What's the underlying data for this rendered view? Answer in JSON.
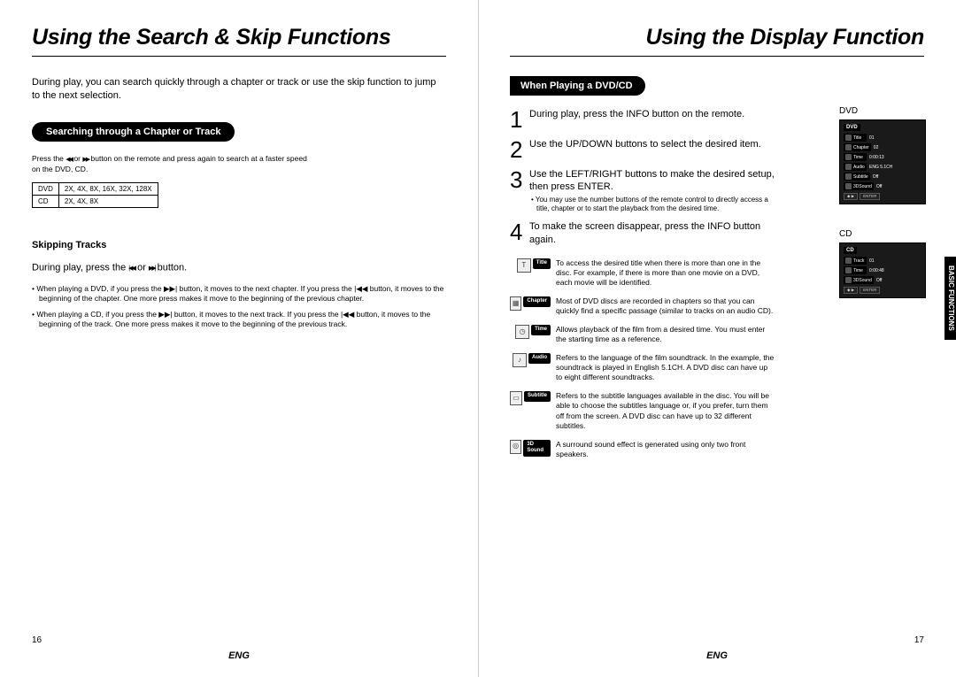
{
  "leftPage": {
    "title": "Using the Search & Skip Functions",
    "intro": "During play, you can search quickly through a chapter or track or use the skip function to jump to the next selection.",
    "section1": {
      "heading": "Searching through a Chapter or Track",
      "line_a": "Press the",
      "line_b": "or",
      "line_c": "button on the remote and press again to search at a faster speed",
      "line2": "on the DVD, CD.",
      "table": {
        "r1c1": "DVD",
        "r1c2": "2X, 4X, 8X, 16X, 32X, 128X",
        "r2c1": "CD",
        "r2c2": "2X, 4X, 8X"
      }
    },
    "section2": {
      "heading": "Skipping Tracks",
      "body_a": "During play, press the",
      "body_b": "or",
      "body_c": "button.",
      "b1": "• When playing a DVD, if you press the ▶▶| button, it moves to the next chapter. If you press the |◀◀ button, it moves to the beginning of the chapter. One more press makes it move to the beginning of the previous chapter.",
      "b2": "• When playing a CD, if you press the ▶▶| button, it moves to the next track. If you press the |◀◀ button, it moves to the beginning of the track. One more press makes it move to the beginning of the previous track."
    },
    "pageNum": "16",
    "lang": "ENG"
  },
  "rightPage": {
    "title": "Using the Display Function",
    "pill": "When Playing a DVD/CD",
    "steps": {
      "s1": "During play, press the INFO button on the remote.",
      "s2": "Use the UP/DOWN buttons to select the desired item.",
      "s3": "Use the LEFT/RIGHT buttons to make the desired setup, then press ENTER.",
      "s3note": "• You may use the number buttons of the remote control to directly access a title, chapter or to start the playback from the desired time.",
      "s4": "To make the screen disappear, press the INFO button again."
    },
    "info": {
      "title": {
        "label": "Title",
        "text": "To access the desired title when there is more than one in the disc. For example, if there is more than one movie on a DVD, each movie will be identified."
      },
      "chapter": {
        "label": "Chapter",
        "text": "Most of DVD discs are recorded in chapters so that you can quickly find a specific passage (similar to tracks on an audio CD)."
      },
      "time": {
        "label": "Time",
        "text": "Allows playback of the film from a desired time. You must enter the starting time as a reference."
      },
      "audio": {
        "label": "Audio",
        "text": "Refers to the language of the film soundtrack. In the example, the soundtrack is played in English 5.1CH. A DVD disc can have up to eight different soundtracks."
      },
      "subtitle": {
        "label": "Subtitle",
        "text": "Refers to the subtitle languages available in the disc. You will be able to choose the subtitles language or, if you prefer, turn them off from the screen. A DVD disc can have up to 32 different subtitles."
      },
      "sound": {
        "label": "3D Sound",
        "text": "A surround sound effect is generated using only two front speakers."
      }
    },
    "dvdLabel": "DVD",
    "cdLabel": "CD",
    "osdDvd": {
      "hdr": "DVD",
      "rows": [
        {
          "tag": "Title",
          "val": "01"
        },
        {
          "tag": "Chapter",
          "val": "02"
        },
        {
          "tag": "Time",
          "val": "0:00:13"
        },
        {
          "tag": "Audio",
          "val": "ENG 5.1CH"
        },
        {
          "tag": "Subtitle",
          "val": "Off"
        },
        {
          "tag": "3DSound",
          "val": "Off"
        }
      ],
      "btn1": "◆ ▶",
      "btn2": "ENTER"
    },
    "osdCd": {
      "hdr": "CD",
      "rows": [
        {
          "tag": "Track",
          "val": "01"
        },
        {
          "tag": "Time",
          "val": "0:00:48"
        },
        {
          "tag": "3DSound",
          "val": "Off"
        }
      ],
      "btn1": "◆ ▶",
      "btn2": "ENTER"
    },
    "sideTab": "BASIC FUNCTIONS",
    "pageNum": "17",
    "lang": "ENG"
  }
}
